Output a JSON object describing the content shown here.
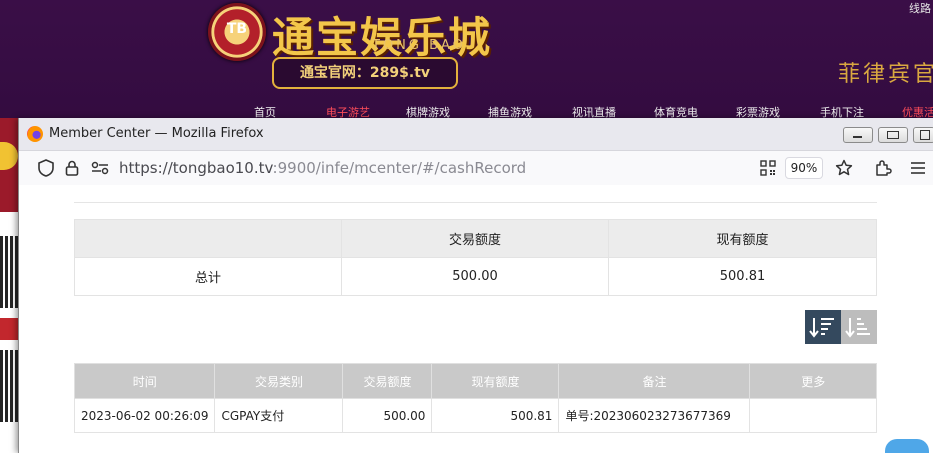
{
  "background_site": {
    "logo_chip": "TB",
    "logo_title": "通宝娱乐城",
    "logo_subtitle": "TONG BAO",
    "official_site": "通宝官网：289$.tv",
    "top_right": "线路",
    "slogan": "菲律宾官",
    "nav": [
      "首页",
      "电子游艺",
      "棋牌游戏",
      "捕鱼游戏",
      "视讯直播",
      "体育竞电",
      "彩票游戏",
      "手机下注",
      "优惠活"
    ]
  },
  "window": {
    "title": "Member Center — Mozilla Firefox"
  },
  "navbar": {
    "url_main": "https://tongbao10.tv",
    "url_rest": ":9900/infe/mcenter/#/cashRecord",
    "zoom": "90%"
  },
  "summary": {
    "headers": [
      "",
      "交易额度",
      "现有额度"
    ],
    "row": [
      "总计",
      "500.00",
      "500.81"
    ]
  },
  "records": {
    "columns": [
      "时间",
      "交易类别",
      "交易额度",
      "现有额度",
      "备注",
      "更多"
    ],
    "rows": [
      [
        "2023-06-02 00:26:09",
        "CGPAY支付",
        "500.00",
        "500.81",
        "单号:202306023273677369",
        ""
      ]
    ]
  }
}
